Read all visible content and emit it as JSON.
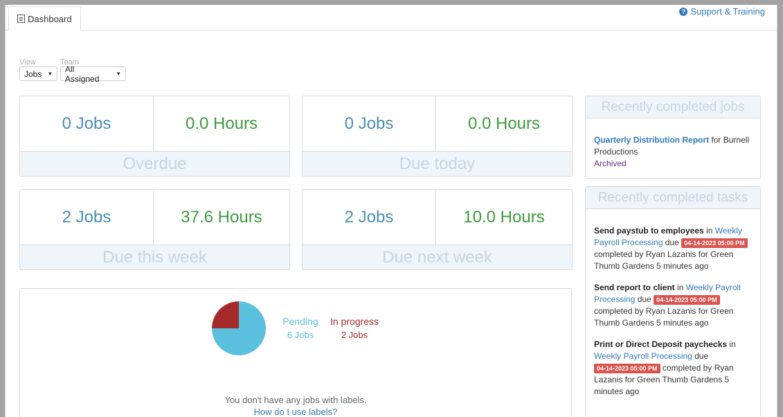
{
  "tabs": {
    "dashboard": "Dashboard"
  },
  "support": {
    "label": "Support & Training"
  },
  "filters": {
    "view_label": "View",
    "view_value": "Jobs",
    "team_label": "Team",
    "team_value": "All Assigned"
  },
  "stats": {
    "overdue": {
      "jobs": "0 Jobs",
      "hours": "0.0 Hours",
      "label": "Overdue"
    },
    "due_today": {
      "jobs": "0 Jobs",
      "hours": "0.0 Hours",
      "label": "Due today"
    },
    "due_this_week": {
      "jobs": "2 Jobs",
      "hours": "37.6 Hours",
      "label": "Due this week"
    },
    "due_next_week": {
      "jobs": "2 Jobs",
      "hours": "10.0 Hours",
      "label": "Due next week"
    }
  },
  "chart_data": {
    "type": "pie",
    "slices": [
      {
        "name": "Pending",
        "label": "6 Jobs",
        "value": 6,
        "color": "#5bc0de"
      },
      {
        "name": "In progress",
        "label": "2 Jobs",
        "value": 2,
        "color": "#a52a2a"
      }
    ]
  },
  "labels": {
    "none_text": "You don't have any jobs with labels.",
    "help_link": "How do I use labels?"
  },
  "recent_jobs": {
    "title": "Recently completed jobs",
    "items": [
      {
        "job": "Quarterly Distribution Report",
        "for": "for Burnell Productions",
        "status": "Archived"
      }
    ]
  },
  "recent_tasks": {
    "title": "Recently completed tasks",
    "items": [
      {
        "task": "Send paystub to employees",
        "in": "in",
        "job": "Weekly Payroll Processing",
        "due_word": "due",
        "due": "04-14-2023 05:00 PM",
        "completed": "completed by Ryan Lazanis for Green Thumb Gardens 5 minutes ago"
      },
      {
        "task": "Send report to client",
        "in": "in",
        "job": "Weekly Payroll Processing",
        "due_word": "due",
        "due": "04-14-2023 05:00 PM",
        "completed": "completed by Ryan Lazanis for Green Thumb Gardens 5 minutes ago"
      },
      {
        "task": "Print or Direct Deposit paychecks",
        "in": "in",
        "job": "Weekly Payroll Processing",
        "due_word": "due",
        "due": "04-14-2023 05:00 PM",
        "completed": "completed by Ryan Lazanis for Green Thumb Gardens 5 minutes ago"
      }
    ]
  },
  "colors": {
    "accent": "#337ab7",
    "jobs": "#4a8db5",
    "hours": "#3e9a41",
    "badge": "#d9534f"
  }
}
